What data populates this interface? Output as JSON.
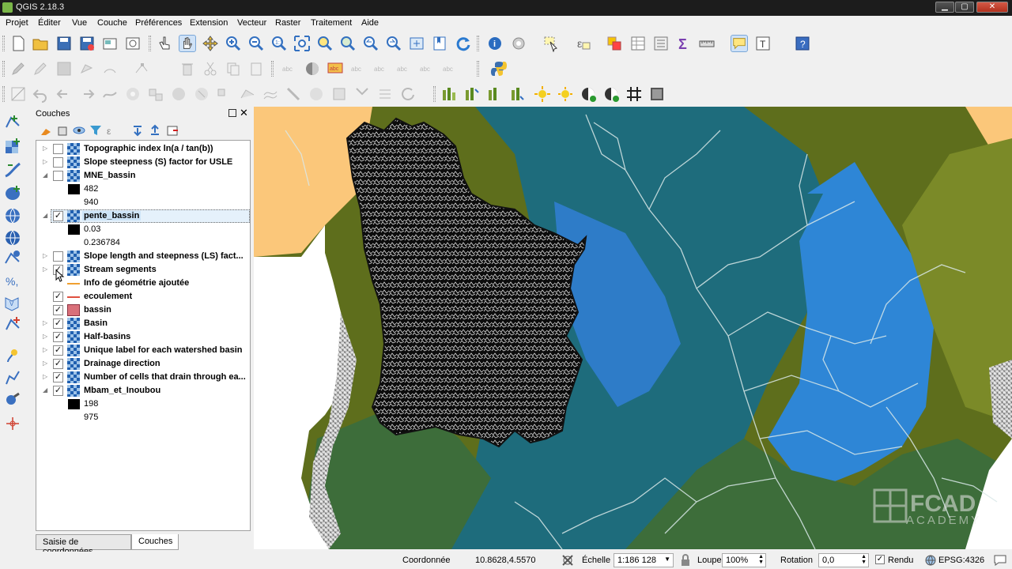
{
  "window": {
    "title": "QGIS 2.18.3"
  },
  "menu": [
    "Projet",
    "Éditer",
    "Vue",
    "Couche",
    "Préférences",
    "Extension",
    "Vecteur",
    "Raster",
    "Traitement",
    "Aide"
  ],
  "panel": {
    "title": "Couches"
  },
  "layers": [
    {
      "name": "Topographic index ln(a / tan(b))",
      "checked": false,
      "expanded": false,
      "icon": "raster-icon"
    },
    {
      "name": "Slope steepness (S) factor for USLE",
      "checked": false,
      "expanded": false,
      "icon": "raster-icon"
    },
    {
      "name": "MNE_bassin",
      "checked": false,
      "expanded": true,
      "icon": "raster-icon",
      "legend": [
        "482",
        "940"
      ]
    },
    {
      "name": "pente_bassin",
      "checked": true,
      "expanded": true,
      "icon": "raster-icon",
      "selected": true,
      "legend": [
        "0.03",
        "0.236784"
      ]
    },
    {
      "name": "Slope length and steepness (LS) fact...",
      "checked": false,
      "expanded": false,
      "icon": "raster-icon"
    },
    {
      "name": "Stream segments",
      "checked": true,
      "expanded": false,
      "icon": "raster-icon"
    },
    {
      "name": "Info de géométrie ajoutée",
      "checked": null,
      "icon": "line-icon-orange"
    },
    {
      "name": "ecoulement",
      "checked": true,
      "icon": "line-icon-red"
    },
    {
      "name": "bassin",
      "checked": true,
      "icon": "polygon-icon-pink"
    },
    {
      "name": "Basin",
      "checked": true,
      "expanded": false,
      "icon": "raster-icon"
    },
    {
      "name": "Half-basins",
      "checked": true,
      "expanded": false,
      "icon": "raster-icon"
    },
    {
      "name": "Unique label for each watershed basin",
      "checked": true,
      "expanded": false,
      "icon": "raster-icon"
    },
    {
      "name": "Drainage direction",
      "checked": true,
      "expanded": false,
      "icon": "raster-icon"
    },
    {
      "name": "Number of cells that drain through ea...",
      "checked": true,
      "expanded": false,
      "icon": "raster-icon"
    },
    {
      "name": "Mbam_et_Inoubou",
      "checked": true,
      "expanded": true,
      "icon": "raster-icon",
      "legend": [
        "198",
        "975"
      ]
    }
  ],
  "tabs": {
    "coords": "Saisie de coordonnées",
    "layers": "Couches"
  },
  "status": {
    "coord_label": "Coordonnée",
    "coord_value": "10.8628,4.5570",
    "scale_label": "Échelle",
    "scale_value": "1:186 128",
    "magnifier_label": "Loupe",
    "magnifier_value": "100%",
    "rotation_label": "Rotation",
    "rotation_value": "0,0",
    "render_label": "Rendu",
    "crs": "EPSG:4326"
  },
  "watermark": {
    "line1": "FCAD",
    "line2": "ACADEMY"
  },
  "colors": {
    "map_orange": "#fbc77a",
    "map_olive": "#6e7b1b",
    "map_teal": "#1e6c7c",
    "map_blue": "#2e86d6",
    "map_green": "#3d6d3a",
    "selection": "#cde4f7"
  }
}
